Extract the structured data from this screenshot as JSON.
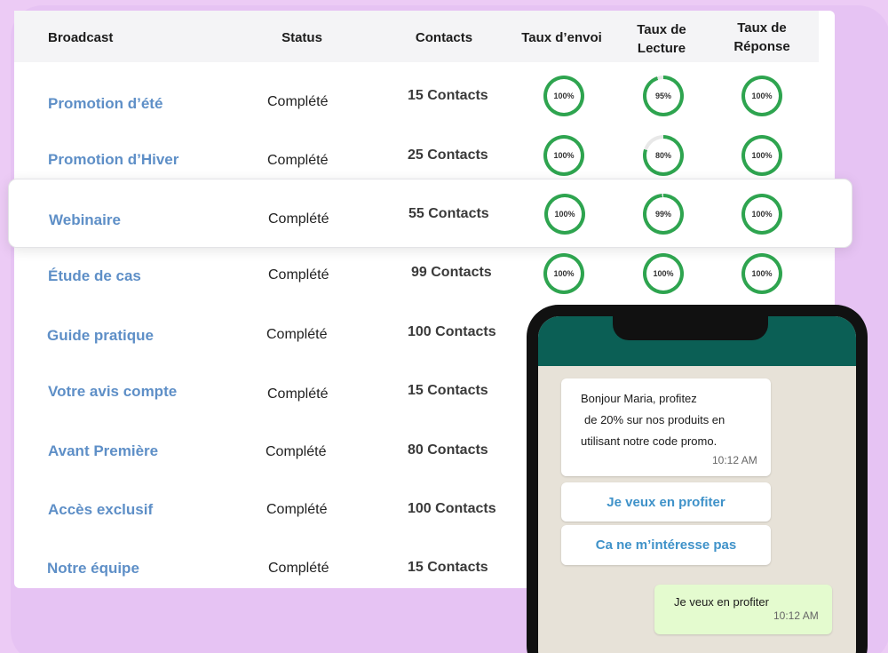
{
  "headers": {
    "broadcast": "Broadcast",
    "status": "Status",
    "contacts": "Contacts",
    "send_rate": "Taux d’envoi",
    "read_rate_1": "Taux de",
    "read_rate_2": "Lecture",
    "reply_rate_1": "Taux de",
    "reply_rate_2": "Réponse"
  },
  "rows": [
    {
      "name": "Promotion d’été",
      "status": "Complété",
      "contacts": "15 Contacts",
      "send": "100%",
      "read": "95%",
      "reply": "100%",
      "send_v": 100,
      "read_v": 95,
      "reply_v": 100
    },
    {
      "name": "Promotion d’Hiver",
      "status": "Complété",
      "contacts": "25 Contacts",
      "send": "100%",
      "read": "80%",
      "reply": "100%",
      "send_v": 100,
      "read_v": 80,
      "reply_v": 100
    },
    {
      "name": "Webinaire",
      "status": "Complété",
      "contacts": "55 Contacts",
      "send": "100%",
      "read": "99%",
      "reply": "100%",
      "send_v": 100,
      "read_v": 99,
      "reply_v": 100
    },
    {
      "name": "Étude de cas",
      "status": "Complété",
      "contacts": "99 Contacts",
      "send": "100%",
      "read": "100%",
      "reply": "100%",
      "send_v": 100,
      "read_v": 100,
      "reply_v": 100
    },
    {
      "name": "Guide pratique",
      "status": "Complété",
      "contacts": "100 Contacts"
    },
    {
      "name": "Votre avis compte",
      "status": "Complété",
      "contacts": "15 Contacts"
    },
    {
      "name": "Avant Première",
      "status": "Complété",
      "contacts": "80 Contacts"
    },
    {
      "name": "Accès exclusif",
      "status": "Complété",
      "contacts": "100 Contacts"
    },
    {
      "name": "Notre équipe",
      "status": "Complété",
      "contacts": "15 Contacts"
    }
  ],
  "colors": {
    "ring_green": "#2ea44f",
    "ring_track": "#e8e8e8",
    "name_blue": "#5e8fc7",
    "whatsapp_header": "#0b5f55"
  },
  "chat": {
    "incoming_line1": "Bonjour Maria, profitez",
    "incoming_line2": "de 20% sur nos produits en",
    "incoming_line3": "utilisant notre code promo.",
    "incoming_time": "10:12 AM",
    "button_yes": "Je veux en profiter",
    "button_no": "Ca ne m’intéresse pas",
    "outgoing_text": "Je veux en profiter",
    "outgoing_time": "10:12 AM"
  }
}
